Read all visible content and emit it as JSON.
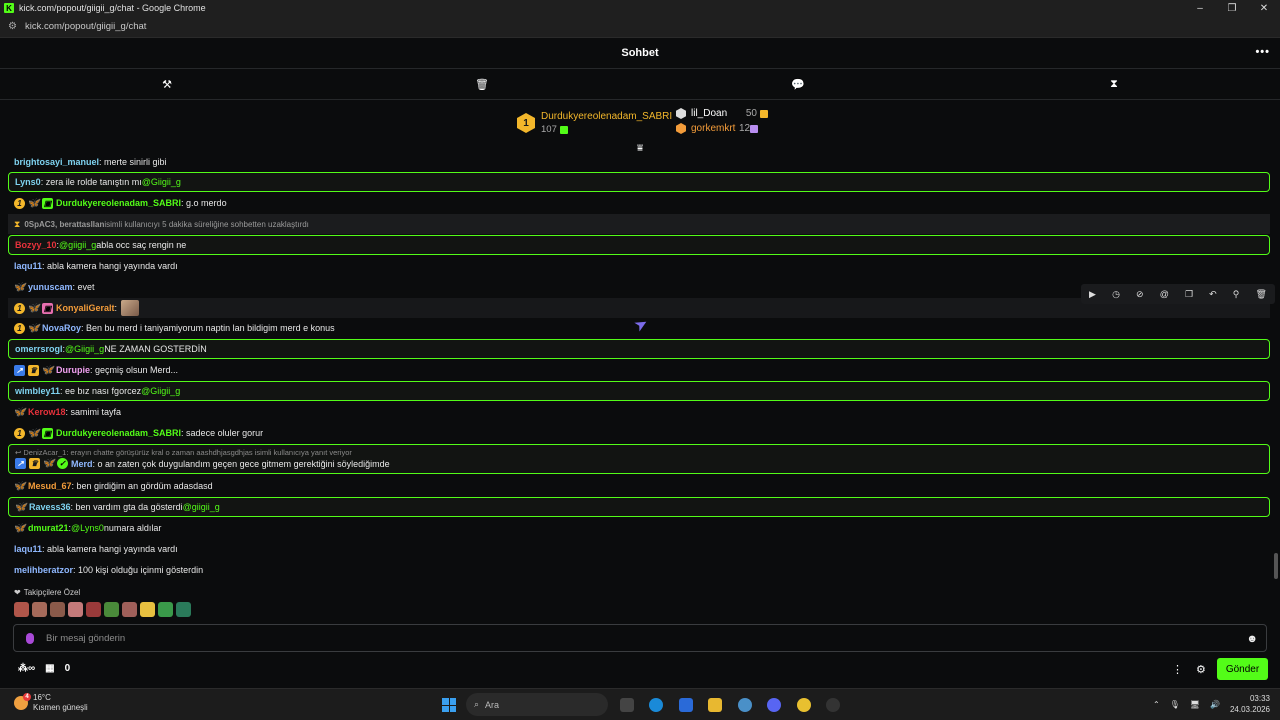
{
  "browser": {
    "title": "kick.com/popout/giigii_g/chat - Google Chrome",
    "url": "kick.com/popout/giigii_g/chat"
  },
  "header": {
    "title": "Sohbet"
  },
  "leaderboard": {
    "first": {
      "rank": "1",
      "name": "Durdukyereolenadam_SABRI",
      "value": "107"
    },
    "second": {
      "name": "lil_Doan",
      "value": "50"
    },
    "third": {
      "name": "gorkemkrt",
      "value": "12"
    }
  },
  "messages": [
    {
      "user": "brightosayi_manuel",
      "color": "#7fd3f0",
      "text": ": merte sinirli gibi"
    },
    {
      "user": "Lyns0",
      "color": "#7fd3f0",
      "text": ": zera ile rolde tanıştın mı ",
      "mention": "@Giigii_g"
    },
    {
      "user": "Durdukyereolenadam_SABRI",
      "color": "#53fc18",
      "text": ": g.o merdo"
    },
    {
      "sys_user": "0SpAC3, berattasllan",
      "sys_text": " isimli kullanıcıyı 5 dakika süreliğine sohbetten uzaklaştırdı"
    },
    {
      "user": "Bozyy_10",
      "color": "#e8323c",
      "pre": ": ",
      "mention": "@giigii_g",
      "text": " abla occ saç rengin ne"
    },
    {
      "user": "laqu11",
      "color": "#8fb8ff",
      "text": ": abla kamera hangi yayında vardı"
    },
    {
      "user": "yunuscam",
      "color": "#8fb8ff",
      "text": ": evet"
    },
    {
      "user": "KonyaliGeralt",
      "color": "#f39c3a",
      "text": ": "
    },
    {
      "user": "NovaRoy",
      "color": "#8fb8ff",
      "text": ": Ben bu merd i taniyamiyorum naptin lan bildigim merd e konus"
    },
    {
      "user": "omerrsrogl",
      "color": "#7fd3f0",
      "pre": ": ",
      "mention": "@Giigii_g",
      "text": " NE ZAMAN GOSTERDİN"
    },
    {
      "user": "Durupie",
      "color": "#f0a0f0",
      "text": ": geçmiş olsun Merd..."
    },
    {
      "user": "wimbley11",
      "color": "#7fd3f0",
      "text": ": ee bız nası fgorcez ",
      "mention": "@Giigii_g"
    },
    {
      "user": "Kerow18",
      "color": "#e8323c",
      "text": ": samimi tayfa"
    },
    {
      "user": "Durdukyereolenadam_SABRI",
      "color": "#53fc18",
      "text": ": sadece oluler gorur"
    },
    {
      "reply": "DenizAcar_1: erayın chatte görüşürüz kral o zaman aashdhjasgdhjas isimli kullanıcıya yanıt veriyor",
      "user": "Merd",
      "color": "#8fb8ff",
      "text": ": o an zaten çok duygulandım geçen gece gitmem gerektiğini söylediğimde"
    },
    {
      "user": "Mesud_67",
      "color": "#f39c3a",
      "text": ": ben girdiğim an gördüm adasdasd"
    },
    {
      "user": "Ravess36",
      "color": "#7fd3f0",
      "text": ": ben vardım gta da gösterdi ",
      "mention": "@giigii_g"
    },
    {
      "user": "dmurat21",
      "color": "#53fc18",
      "pre": ": ",
      "mention": "@Lyns0",
      "text": " numara aldılar"
    },
    {
      "user": "laqu11",
      "color": "#8fb8ff",
      "text": ": abla kamera hangi yayında vardı"
    },
    {
      "user": "melihberatzor",
      "color": "#8fb8ff",
      "text": ": 100 kişi olduğu içinmi gösterdin"
    }
  ],
  "followers_label": "Takipçilere Özel",
  "input": {
    "placeholder": "Bir mesaj gönderin"
  },
  "bottom": {
    "count": "0",
    "send_label": "Gönder"
  },
  "taskbar": {
    "temp": "16°C",
    "weather": "Kısmen güneşli",
    "weather_badge": "4",
    "search": "Ara",
    "time": "03:33",
    "date": "24.03.2026"
  }
}
